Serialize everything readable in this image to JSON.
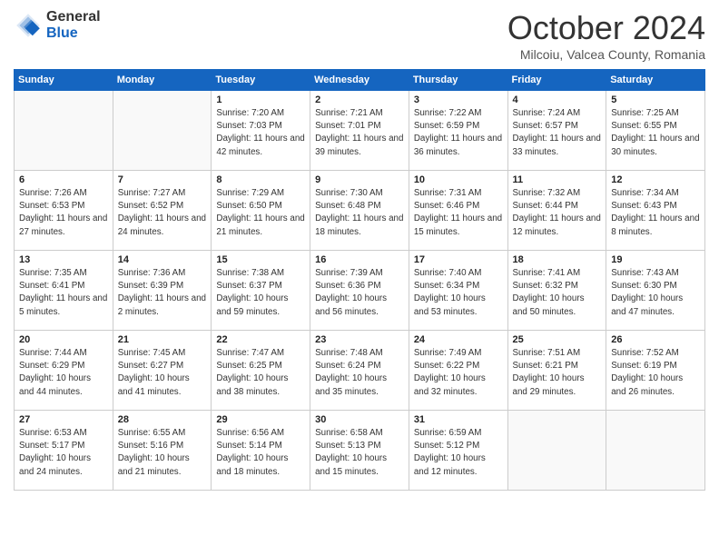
{
  "header": {
    "logo_line1": "General",
    "logo_line2": "Blue",
    "month": "October 2024",
    "location": "Milcoiu, Valcea County, Romania"
  },
  "weekdays": [
    "Sunday",
    "Monday",
    "Tuesday",
    "Wednesday",
    "Thursday",
    "Friday",
    "Saturday"
  ],
  "weeks": [
    [
      {
        "day": "",
        "sunrise": "",
        "sunset": "",
        "daylight": ""
      },
      {
        "day": "",
        "sunrise": "",
        "sunset": "",
        "daylight": ""
      },
      {
        "day": "1",
        "sunrise": "Sunrise: 7:20 AM",
        "sunset": "Sunset: 7:03 PM",
        "daylight": "Daylight: 11 hours and 42 minutes."
      },
      {
        "day": "2",
        "sunrise": "Sunrise: 7:21 AM",
        "sunset": "Sunset: 7:01 PM",
        "daylight": "Daylight: 11 hours and 39 minutes."
      },
      {
        "day": "3",
        "sunrise": "Sunrise: 7:22 AM",
        "sunset": "Sunset: 6:59 PM",
        "daylight": "Daylight: 11 hours and 36 minutes."
      },
      {
        "day": "4",
        "sunrise": "Sunrise: 7:24 AM",
        "sunset": "Sunset: 6:57 PM",
        "daylight": "Daylight: 11 hours and 33 minutes."
      },
      {
        "day": "5",
        "sunrise": "Sunrise: 7:25 AM",
        "sunset": "Sunset: 6:55 PM",
        "daylight": "Daylight: 11 hours and 30 minutes."
      }
    ],
    [
      {
        "day": "6",
        "sunrise": "Sunrise: 7:26 AM",
        "sunset": "Sunset: 6:53 PM",
        "daylight": "Daylight: 11 hours and 27 minutes."
      },
      {
        "day": "7",
        "sunrise": "Sunrise: 7:27 AM",
        "sunset": "Sunset: 6:52 PM",
        "daylight": "Daylight: 11 hours and 24 minutes."
      },
      {
        "day": "8",
        "sunrise": "Sunrise: 7:29 AM",
        "sunset": "Sunset: 6:50 PM",
        "daylight": "Daylight: 11 hours and 21 minutes."
      },
      {
        "day": "9",
        "sunrise": "Sunrise: 7:30 AM",
        "sunset": "Sunset: 6:48 PM",
        "daylight": "Daylight: 11 hours and 18 minutes."
      },
      {
        "day": "10",
        "sunrise": "Sunrise: 7:31 AM",
        "sunset": "Sunset: 6:46 PM",
        "daylight": "Daylight: 11 hours and 15 minutes."
      },
      {
        "day": "11",
        "sunrise": "Sunrise: 7:32 AM",
        "sunset": "Sunset: 6:44 PM",
        "daylight": "Daylight: 11 hours and 12 minutes."
      },
      {
        "day": "12",
        "sunrise": "Sunrise: 7:34 AM",
        "sunset": "Sunset: 6:43 PM",
        "daylight": "Daylight: 11 hours and 8 minutes."
      }
    ],
    [
      {
        "day": "13",
        "sunrise": "Sunrise: 7:35 AM",
        "sunset": "Sunset: 6:41 PM",
        "daylight": "Daylight: 11 hours and 5 minutes."
      },
      {
        "day": "14",
        "sunrise": "Sunrise: 7:36 AM",
        "sunset": "Sunset: 6:39 PM",
        "daylight": "Daylight: 11 hours and 2 minutes."
      },
      {
        "day": "15",
        "sunrise": "Sunrise: 7:38 AM",
        "sunset": "Sunset: 6:37 PM",
        "daylight": "Daylight: 10 hours and 59 minutes."
      },
      {
        "day": "16",
        "sunrise": "Sunrise: 7:39 AM",
        "sunset": "Sunset: 6:36 PM",
        "daylight": "Daylight: 10 hours and 56 minutes."
      },
      {
        "day": "17",
        "sunrise": "Sunrise: 7:40 AM",
        "sunset": "Sunset: 6:34 PM",
        "daylight": "Daylight: 10 hours and 53 minutes."
      },
      {
        "day": "18",
        "sunrise": "Sunrise: 7:41 AM",
        "sunset": "Sunset: 6:32 PM",
        "daylight": "Daylight: 10 hours and 50 minutes."
      },
      {
        "day": "19",
        "sunrise": "Sunrise: 7:43 AM",
        "sunset": "Sunset: 6:30 PM",
        "daylight": "Daylight: 10 hours and 47 minutes."
      }
    ],
    [
      {
        "day": "20",
        "sunrise": "Sunrise: 7:44 AM",
        "sunset": "Sunset: 6:29 PM",
        "daylight": "Daylight: 10 hours and 44 minutes."
      },
      {
        "day": "21",
        "sunrise": "Sunrise: 7:45 AM",
        "sunset": "Sunset: 6:27 PM",
        "daylight": "Daylight: 10 hours and 41 minutes."
      },
      {
        "day": "22",
        "sunrise": "Sunrise: 7:47 AM",
        "sunset": "Sunset: 6:25 PM",
        "daylight": "Daylight: 10 hours and 38 minutes."
      },
      {
        "day": "23",
        "sunrise": "Sunrise: 7:48 AM",
        "sunset": "Sunset: 6:24 PM",
        "daylight": "Daylight: 10 hours and 35 minutes."
      },
      {
        "day": "24",
        "sunrise": "Sunrise: 7:49 AM",
        "sunset": "Sunset: 6:22 PM",
        "daylight": "Daylight: 10 hours and 32 minutes."
      },
      {
        "day": "25",
        "sunrise": "Sunrise: 7:51 AM",
        "sunset": "Sunset: 6:21 PM",
        "daylight": "Daylight: 10 hours and 29 minutes."
      },
      {
        "day": "26",
        "sunrise": "Sunrise: 7:52 AM",
        "sunset": "Sunset: 6:19 PM",
        "daylight": "Daylight: 10 hours and 26 minutes."
      }
    ],
    [
      {
        "day": "27",
        "sunrise": "Sunrise: 6:53 AM",
        "sunset": "Sunset: 5:17 PM",
        "daylight": "Daylight: 10 hours and 24 minutes."
      },
      {
        "day": "28",
        "sunrise": "Sunrise: 6:55 AM",
        "sunset": "Sunset: 5:16 PM",
        "daylight": "Daylight: 10 hours and 21 minutes."
      },
      {
        "day": "29",
        "sunrise": "Sunrise: 6:56 AM",
        "sunset": "Sunset: 5:14 PM",
        "daylight": "Daylight: 10 hours and 18 minutes."
      },
      {
        "day": "30",
        "sunrise": "Sunrise: 6:58 AM",
        "sunset": "Sunset: 5:13 PM",
        "daylight": "Daylight: 10 hours and 15 minutes."
      },
      {
        "day": "31",
        "sunrise": "Sunrise: 6:59 AM",
        "sunset": "Sunset: 5:12 PM",
        "daylight": "Daylight: 10 hours and 12 minutes."
      },
      {
        "day": "",
        "sunrise": "",
        "sunset": "",
        "daylight": ""
      },
      {
        "day": "",
        "sunrise": "",
        "sunset": "",
        "daylight": ""
      }
    ]
  ]
}
